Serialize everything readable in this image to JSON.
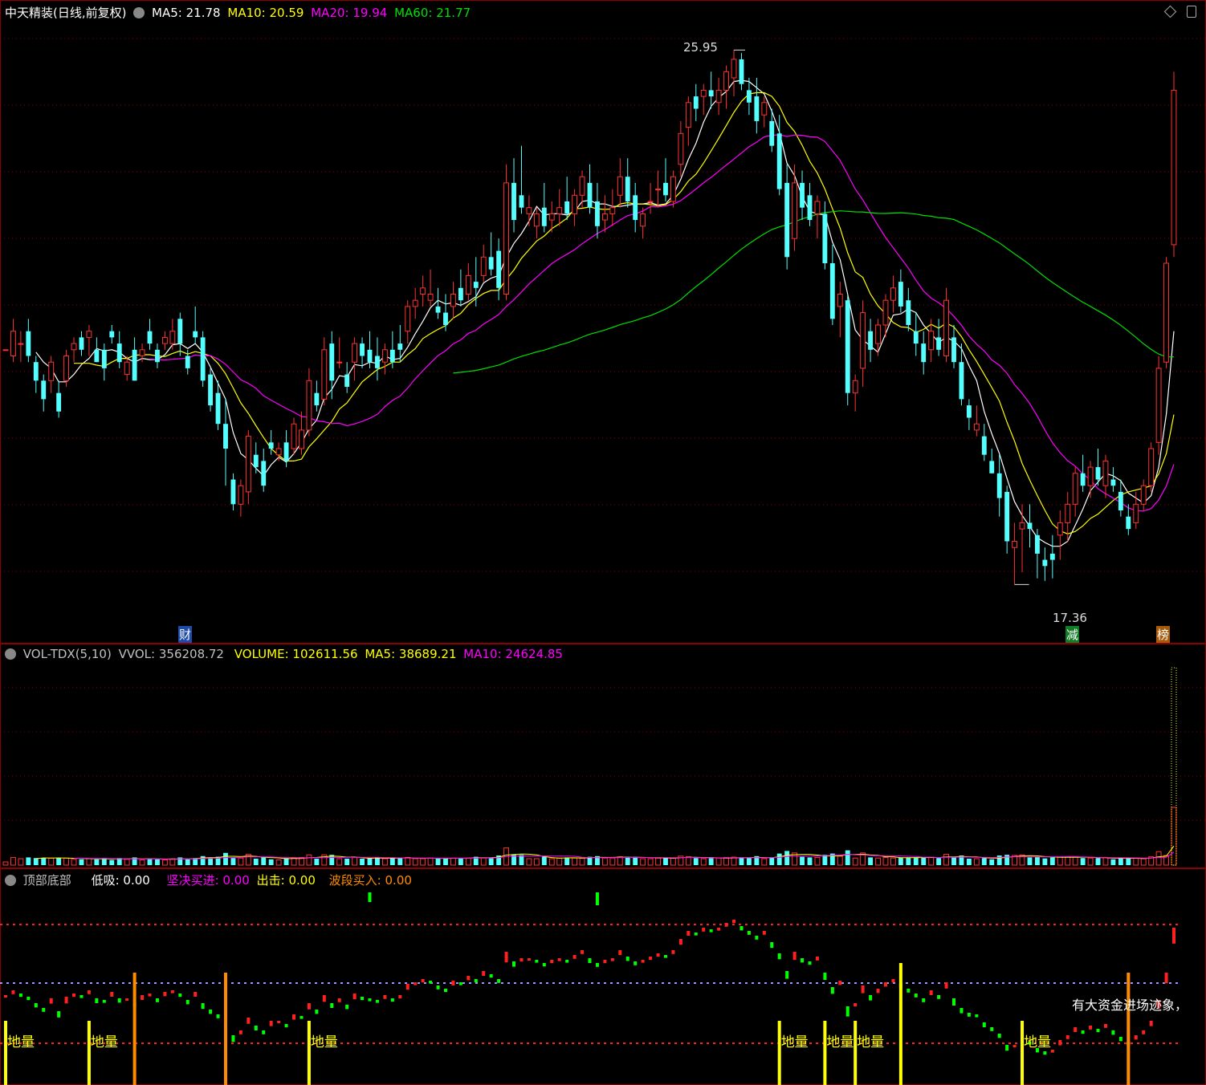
{
  "colors": {
    "bg": "#000000",
    "up": "#ff3232",
    "down": "#54ffff",
    "ma5": "#ffffff",
    "ma10": "#ffff00",
    "ma20": "#ff00ff",
    "ma60": "#00e000",
    "grid_red": "#8b0000",
    "text_white": "#ffffff",
    "text_yellow": "#ffff00",
    "text_magenta": "#ff00ff",
    "text_green": "#00ff00",
    "text_orange": "#ff8c00",
    "text_gray": "#c0c0c0",
    "signal_green": "#00ff00",
    "signal_yellow": "#ffff00",
    "signal_orange": "#ff8c00"
  },
  "header": {
    "stock": "中天精装(日线,前复权)",
    "ma5_label": "MA5:",
    "ma5_value": "21.78",
    "ma10_label": "MA10:",
    "ma10_value": "20.59",
    "ma20_label": "MA20:",
    "ma20_value": "19.94",
    "ma60_label": "MA60:",
    "ma60_value": "21.77",
    "high_label": "25.95",
    "low_label": "17.36",
    "markers": [
      "财",
      "减",
      "榜"
    ]
  },
  "volume_header": {
    "name": "VOL-TDX(5,10)",
    "vvol_label": "VVOL:",
    "vvol_value": "356208.72",
    "volume_label": "VOLUME:",
    "volume_value": "102611.56",
    "ma5_label": "MA5:",
    "ma5_value": "38689.21",
    "ma10_label": "MA10:",
    "ma10_value": "24624.85"
  },
  "indicator_header": {
    "name": "顶部底部",
    "dixi_label": "低吸:",
    "dixi_value": "0.00",
    "jianjue_label": "坚决买进:",
    "jianjue_value": "0.00",
    "chuji_label": "出击:",
    "chuji_value": "0.00",
    "boduan_label": "波段买入:",
    "boduan_value": "0.00",
    "signal_text": "地量",
    "bottom_note": "有大资金进场迹象，"
  },
  "icons": [
    "diamond-icon",
    "settings-icon",
    "chevron-icon"
  ],
  "chart_data": [
    {
      "type": "candlestick",
      "title": "中天精装(日线,前复权)",
      "ylim": [
        16.5,
        26.5
      ],
      "high_marker": 25.95,
      "low_marker": 17.36,
      "series": [
        {
          "name": "MA5",
          "last": 21.78
        },
        {
          "name": "MA10",
          "last": 20.59
        },
        {
          "name": "MA20",
          "last": 19.94
        },
        {
          "name": "MA60",
          "last": 21.77
        }
      ],
      "candles": [
        [
          21.1,
          21.1,
          21.1,
          21.1
        ],
        [
          21.0,
          21.6,
          20.9,
          21.4
        ],
        [
          21.2,
          21.4,
          20.9,
          21.2
        ],
        [
          21.4,
          21.6,
          20.9,
          21.0
        ],
        [
          20.9,
          21.0,
          20.4,
          20.6
        ],
        [
          20.6,
          20.7,
          20.1,
          20.3
        ],
        [
          20.6,
          21.0,
          20.4,
          20.9
        ],
        [
          20.4,
          20.6,
          20.0,
          20.1
        ],
        [
          20.6,
          21.1,
          20.5,
          21.0
        ],
        [
          21.1,
          21.3,
          20.9,
          21.2
        ],
        [
          21.3,
          21.4,
          21.0,
          21.1
        ],
        [
          21.3,
          21.5,
          21.0,
          21.4
        ],
        [
          21.1,
          21.3,
          20.9,
          20.9
        ],
        [
          21.1,
          21.2,
          20.6,
          20.8
        ],
        [
          21.4,
          21.5,
          21.2,
          21.3
        ],
        [
          21.2,
          21.4,
          20.8,
          20.9
        ],
        [
          20.7,
          21.0,
          20.6,
          20.9
        ],
        [
          21.1,
          21.3,
          20.6,
          20.6
        ],
        [
          21.0,
          21.2,
          20.9,
          21.1
        ],
        [
          21.4,
          21.6,
          21.1,
          21.2
        ],
        [
          21.1,
          21.2,
          20.8,
          20.9
        ],
        [
          21.2,
          21.4,
          21.1,
          21.3
        ],
        [
          21.2,
          21.6,
          21.1,
          21.4
        ],
        [
          21.6,
          21.7,
          21.0,
          21.2
        ],
        [
          21.0,
          21.1,
          20.7,
          20.8
        ],
        [
          21.4,
          21.8,
          21.2,
          21.3
        ],
        [
          21.3,
          21.4,
          20.5,
          20.6
        ],
        [
          20.7,
          20.8,
          20.1,
          20.2
        ],
        [
          20.4,
          20.6,
          19.8,
          19.9
        ],
        [
          19.9,
          20.3,
          18.9,
          19.5
        ],
        [
          19.0,
          19.1,
          18.5,
          18.6
        ],
        [
          18.6,
          19.0,
          18.4,
          18.9
        ],
        [
          18.8,
          19.8,
          18.6,
          19.7
        ],
        [
          19.4,
          19.6,
          19.1,
          19.2
        ],
        [
          19.3,
          19.5,
          18.8,
          18.9
        ],
        [
          19.6,
          19.8,
          19.4,
          19.5
        ],
        [
          19.4,
          19.6,
          19.3,
          19.5
        ],
        [
          19.6,
          19.8,
          19.2,
          19.3
        ],
        [
          19.5,
          20.0,
          19.4,
          19.9
        ],
        [
          19.5,
          20.1,
          19.4,
          19.8
        ],
        [
          19.8,
          20.8,
          19.7,
          20.6
        ],
        [
          20.4,
          20.6,
          20.1,
          20.2
        ],
        [
          20.3,
          21.3,
          20.2,
          21.1
        ],
        [
          21.2,
          21.4,
          20.3,
          20.6
        ],
        [
          20.9,
          21.3,
          20.8,
          20.9
        ],
        [
          20.7,
          20.9,
          20.4,
          20.5
        ],
        [
          20.9,
          21.3,
          20.6,
          21.2
        ],
        [
          21.2,
          21.3,
          20.8,
          21.0
        ],
        [
          21.1,
          21.4,
          20.8,
          20.9
        ],
        [
          21.0,
          21.3,
          20.6,
          20.8
        ],
        [
          20.9,
          21.2,
          20.7,
          21.1
        ],
        [
          21.1,
          21.4,
          20.8,
          20.9
        ],
        [
          21.2,
          21.5,
          20.9,
          21.1
        ],
        [
          21.4,
          21.9,
          21.2,
          21.8
        ],
        [
          21.8,
          22.1,
          21.6,
          21.9
        ],
        [
          22.0,
          22.3,
          21.8,
          22.1
        ],
        [
          21.9,
          22.4,
          21.8,
          22.0
        ],
        [
          21.8,
          22.1,
          21.6,
          21.7
        ],
        [
          21.7,
          22.0,
          21.4,
          21.5
        ],
        [
          21.8,
          22.2,
          21.6,
          22.0
        ],
        [
          22.1,
          22.4,
          21.8,
          21.9
        ],
        [
          22.0,
          22.5,
          21.9,
          22.3
        ],
        [
          22.2,
          22.6,
          21.8,
          22.1
        ],
        [
          22.3,
          22.8,
          22.2,
          22.6
        ],
        [
          22.6,
          23.0,
          22.3,
          22.4
        ],
        [
          22.7,
          22.9,
          21.9,
          22.1
        ],
        [
          22.0,
          24.1,
          21.9,
          23.8
        ],
        [
          23.8,
          24.2,
          23.0,
          23.2
        ],
        [
          23.6,
          24.4,
          23.3,
          23.4
        ],
        [
          23.3,
          23.6,
          23.1,
          23.4
        ],
        [
          23.1,
          23.4,
          22.9,
          23.3
        ],
        [
          23.4,
          23.8,
          23.0,
          23.1
        ],
        [
          23.2,
          23.5,
          23.0,
          23.3
        ],
        [
          23.3,
          23.7,
          23.1,
          23.4
        ],
        [
          23.5,
          23.9,
          23.2,
          23.3
        ],
        [
          23.3,
          23.7,
          23.1,
          23.6
        ],
        [
          23.6,
          24.0,
          23.4,
          23.9
        ],
        [
          23.8,
          24.1,
          23.3,
          23.4
        ],
        [
          23.5,
          23.8,
          22.9,
          23.1
        ],
        [
          23.2,
          23.6,
          23.0,
          23.3
        ],
        [
          23.3,
          23.7,
          23.1,
          23.4
        ],
        [
          23.6,
          24.2,
          23.4,
          23.9
        ],
        [
          23.9,
          24.2,
          23.4,
          23.5
        ],
        [
          23.6,
          23.8,
          23.0,
          23.2
        ],
        [
          23.1,
          23.4,
          22.9,
          23.3
        ],
        [
          23.5,
          23.8,
          23.3,
          23.5
        ],
        [
          23.7,
          24.0,
          23.4,
          23.7
        ],
        [
          23.8,
          24.2,
          23.5,
          23.6
        ],
        [
          23.5,
          24.0,
          23.4,
          23.9
        ],
        [
          24.1,
          24.8,
          23.9,
          24.6
        ],
        [
          24.7,
          25.2,
          24.4,
          25.1
        ],
        [
          25.2,
          25.4,
          24.8,
          25.0
        ],
        [
          25.2,
          25.4,
          24.9,
          25.3
        ],
        [
          25.3,
          25.6,
          25.0,
          25.2
        ],
        [
          25.1,
          25.5,
          24.9,
          25.3
        ],
        [
          25.3,
          25.7,
          25.0,
          25.6
        ],
        [
          25.5,
          25.95,
          25.2,
          25.8
        ],
        [
          25.8,
          25.9,
          25.3,
          25.4
        ],
        [
          25.3,
          25.5,
          24.9,
          25.1
        ],
        [
          25.2,
          25.5,
          24.6,
          24.8
        ],
        [
          24.9,
          25.2,
          24.7,
          25.1
        ],
        [
          24.8,
          25.0,
          24.3,
          24.4
        ],
        [
          24.6,
          24.9,
          23.6,
          23.7
        ],
        [
          23.8,
          24.1,
          22.4,
          22.6
        ],
        [
          22.9,
          24.1,
          22.7,
          23.8
        ],
        [
          23.8,
          24.0,
          23.2,
          23.4
        ],
        [
          23.6,
          23.8,
          23.1,
          23.2
        ],
        [
          23.3,
          23.6,
          22.9,
          23.5
        ],
        [
          23.3,
          23.5,
          22.4,
          22.5
        ],
        [
          22.5,
          22.8,
          21.5,
          21.6
        ],
        [
          21.8,
          22.2,
          21.3,
          22.0
        ],
        [
          21.9,
          22.0,
          20.2,
          20.4
        ],
        [
          20.4,
          20.7,
          20.1,
          20.6
        ],
        [
          20.8,
          21.9,
          20.5,
          21.7
        ],
        [
          21.4,
          21.6,
          20.9,
          21.1
        ],
        [
          21.2,
          21.6,
          21.0,
          21.5
        ],
        [
          21.5,
          22.0,
          21.3,
          21.9
        ],
        [
          21.9,
          22.3,
          21.7,
          22.1
        ],
        [
          22.2,
          22.4,
          21.7,
          21.8
        ],
        [
          21.9,
          22.1,
          21.4,
          21.5
        ],
        [
          21.4,
          21.7,
          21.0,
          21.2
        ],
        [
          21.2,
          21.4,
          20.7,
          20.9
        ],
        [
          21.1,
          21.6,
          20.9,
          21.4
        ],
        [
          21.3,
          21.6,
          21.0,
          21.1
        ],
        [
          21.0,
          22.1,
          20.9,
          21.9
        ],
        [
          21.3,
          21.5,
          20.8,
          20.9
        ],
        [
          20.9,
          21.2,
          20.2,
          20.3
        ],
        [
          20.2,
          20.3,
          19.8,
          20.0
        ],
        [
          19.8,
          20.2,
          19.7,
          19.9
        ],
        [
          19.7,
          19.9,
          19.3,
          19.4
        ],
        [
          19.3,
          19.5,
          19.1,
          19.1
        ],
        [
          19.1,
          19.4,
          18.4,
          18.7
        ],
        [
          18.8,
          18.9,
          17.8,
          18.0
        ],
        [
          17.9,
          18.3,
          17.3,
          18.0
        ],
        [
          18.2,
          18.6,
          17.5,
          18.3
        ],
        [
          18.3,
          18.6,
          17.9,
          18.2
        ],
        [
          18.1,
          18.2,
          17.4,
          17.8
        ],
        [
          17.7,
          17.9,
          17.36,
          17.6
        ],
        [
          17.8,
          18.1,
          17.4,
          17.7
        ],
        [
          18.1,
          18.5,
          17.7,
          18.3
        ],
        [
          18.3,
          18.8,
          18.0,
          18.6
        ],
        [
          18.6,
          19.2,
          18.4,
          19.1
        ],
        [
          19.1,
          19.4,
          18.8,
          18.9
        ],
        [
          18.9,
          19.3,
          18.7,
          19.2
        ],
        [
          19.2,
          19.5,
          18.9,
          19.0
        ],
        [
          18.9,
          19.4,
          18.7,
          19.3
        ],
        [
          19.0,
          19.2,
          18.8,
          18.9
        ],
        [
          18.8,
          19.0,
          18.4,
          18.5
        ],
        [
          18.4,
          18.6,
          18.1,
          18.2
        ],
        [
          18.3,
          18.8,
          18.2,
          18.6
        ],
        [
          18.6,
          19.0,
          18.5,
          18.9
        ],
        [
          18.9,
          19.6,
          18.8,
          19.5
        ],
        [
          19.6,
          21.0,
          19.4,
          20.8
        ],
        [
          20.9,
          22.6,
          20.8,
          22.5
        ],
        [
          22.8,
          25.6,
          22.6,
          25.3
        ]
      ]
    },
    {
      "type": "bar",
      "title": "VOL-TDX(5,10)",
      "series": [
        {
          "name": "VOLUME",
          "last": 102611.56
        },
        {
          "name": "MA5",
          "last": 38689.21
        },
        {
          "name": "MA10",
          "last": 24624.85
        }
      ],
      "vvol": 356208.72
    },
    {
      "type": "line",
      "title": "顶部底部",
      "series": [
        {
          "name": "低吸",
          "last": 0.0
        },
        {
          "name": "坚决买进",
          "last": 0.0
        },
        {
          "name": "出击",
          "last": 0.0
        },
        {
          "name": "波段买入",
          "last": 0.0
        }
      ]
    }
  ]
}
